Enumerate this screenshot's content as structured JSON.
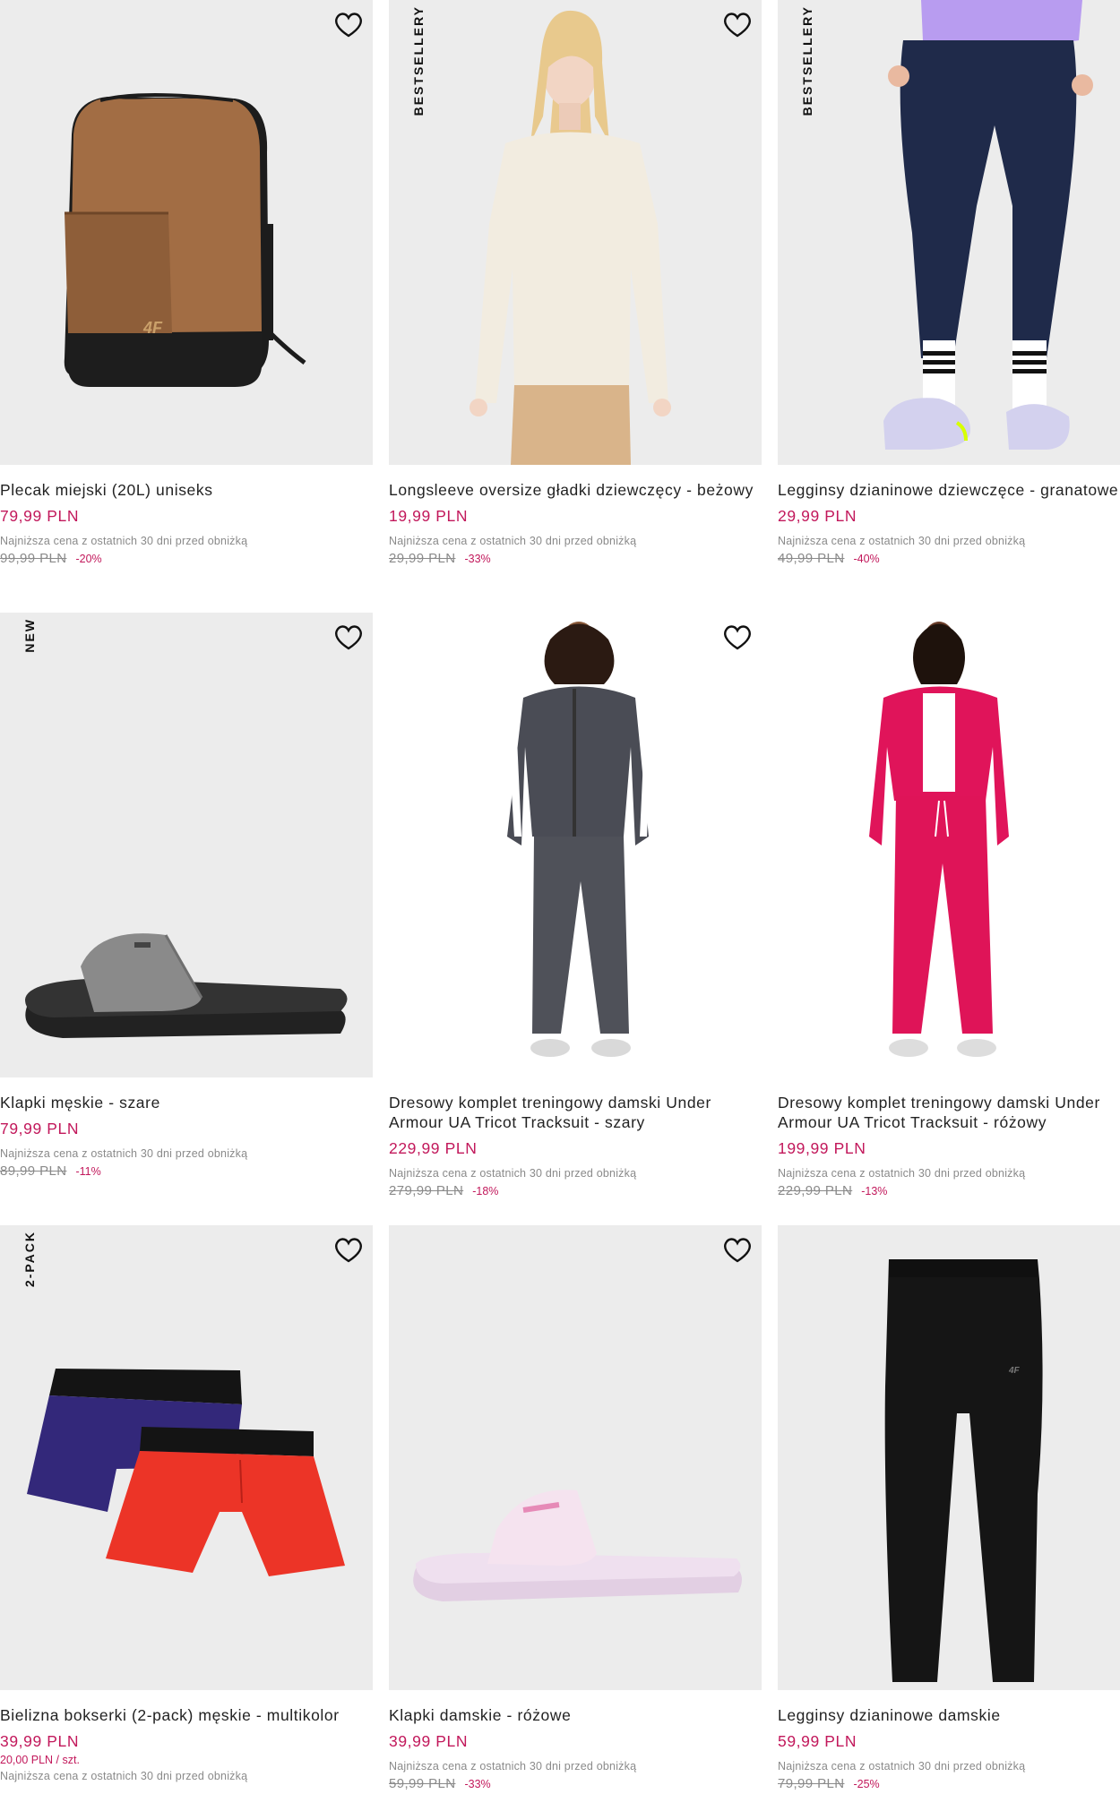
{
  "lowest_price_label": "Najniższa cena z ostatnich 30 dni przed obniżką",
  "colors": {
    "price": "#c2185b",
    "muted": "#8a8a8a",
    "tile_bg": "#ececec"
  },
  "products": [
    {
      "name": "Plecak miejski (20L) uniseks",
      "price": "79,99 PLN",
      "old_price": "99,99 PLN",
      "discount": "-20%",
      "badge": "",
      "icon": "backpack-image"
    },
    {
      "name": "Longsleeve oversize gładki dziewczęcy - beżowy",
      "price": "19,99 PLN",
      "old_price": "29,99 PLN",
      "discount": "-33%",
      "badge": "BESTSELLERY",
      "icon": "longsleeve-image"
    },
    {
      "name": "Legginsy dzianinowe dziewczęce - granatowe",
      "price": "29,99 PLN",
      "old_price": "49,99 PLN",
      "discount": "-40%",
      "badge": "BESTSELLERY",
      "icon": "leggings-navy-image"
    },
    {
      "name": "Klapki męskie - szare",
      "price": "79,99 PLN",
      "old_price": "89,99 PLN",
      "discount": "-11%",
      "badge": "NEW",
      "icon": "slides-grey-image"
    },
    {
      "name": "Dresowy komplet treningowy damski Under Armour UA Tricot Tracksuit - szary",
      "price": "229,99 PLN",
      "old_price": "279,99 PLN",
      "discount": "-18%",
      "badge": "",
      "icon": "tracksuit-grey-image"
    },
    {
      "name": "Dresowy komplet treningowy damski Under Armour UA Tricot Tracksuit - różowy",
      "price": "199,99 PLN",
      "old_price": "229,99 PLN",
      "discount": "-13%",
      "badge": "",
      "icon": "tracksuit-pink-image"
    },
    {
      "name": "Bielizna bokserki (2-pack) męskie - multikolor",
      "price": "39,99 PLN",
      "unit_price": "20,00 PLN / szt.",
      "old_price": "",
      "discount": "",
      "badge": "2-PACK",
      "icon": "boxers-image"
    },
    {
      "name": "Klapki damskie - różowe",
      "price": "39,99 PLN",
      "old_price": "59,99 PLN",
      "discount": "-33%",
      "badge": "",
      "icon": "slides-pink-image"
    },
    {
      "name": "Legginsy dzianinowe damskie",
      "price": "59,99 PLN",
      "old_price": "79,99 PLN",
      "discount": "-25%",
      "badge": "",
      "icon": "leggings-black-image"
    }
  ]
}
